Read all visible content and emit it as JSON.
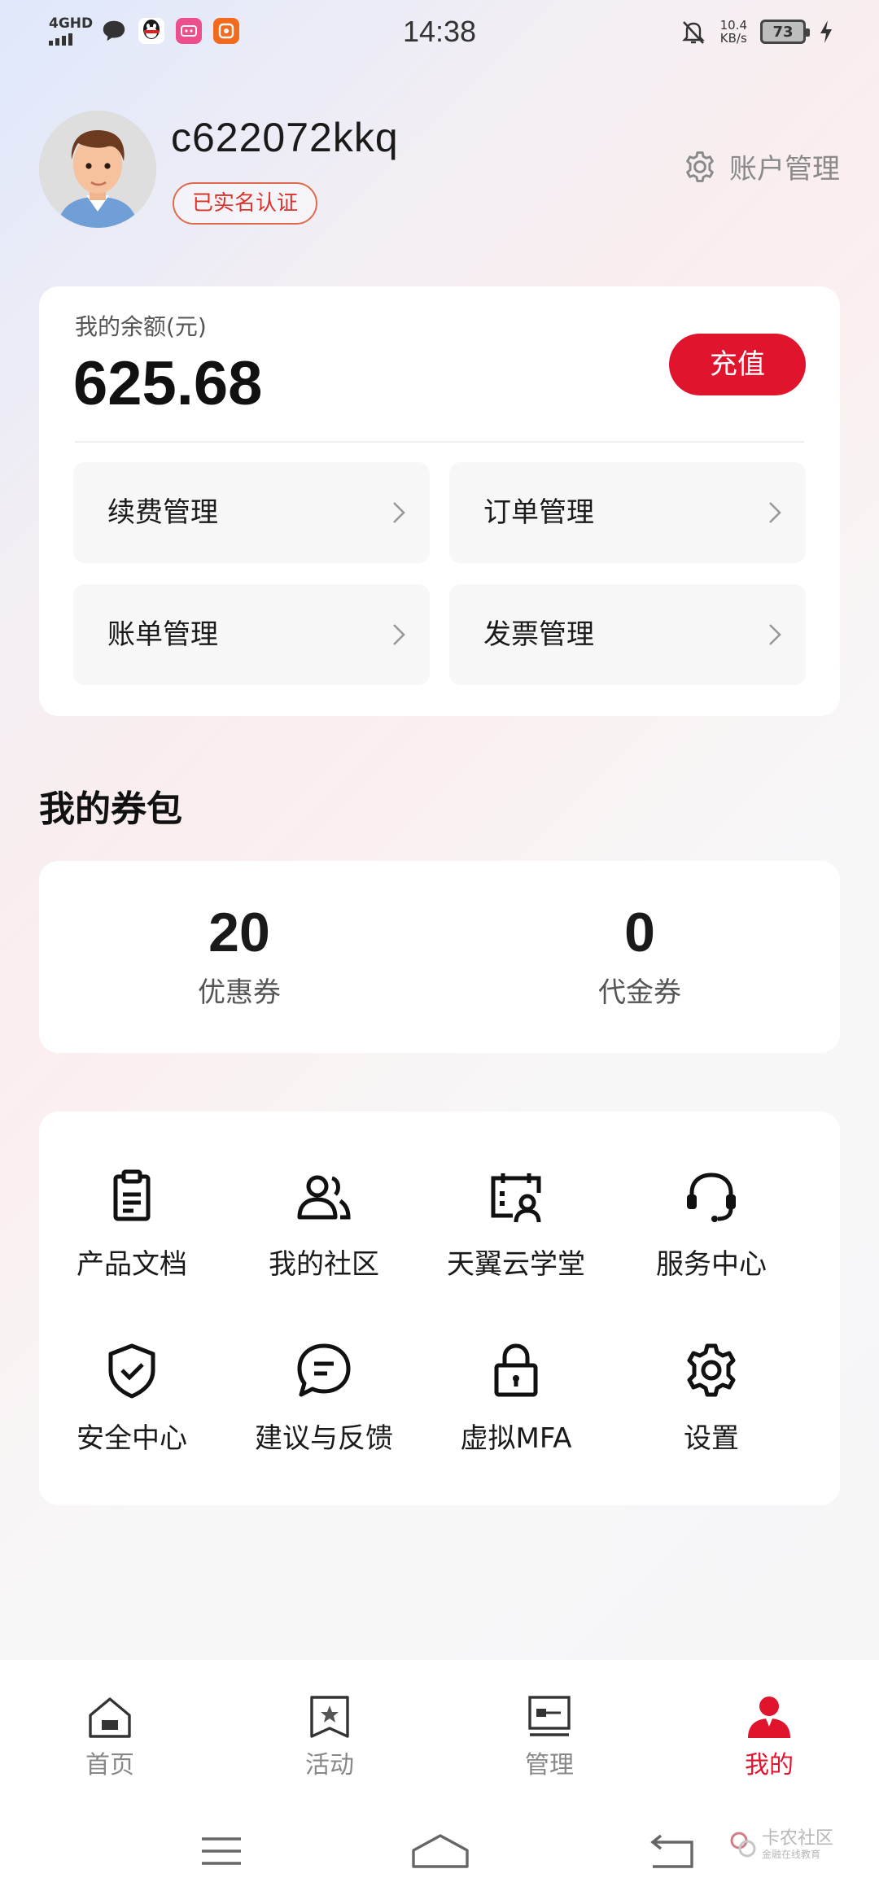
{
  "status_bar": {
    "network": "4GHD",
    "time": "14:38",
    "speed_value": "10.4",
    "speed_unit": "KB/s",
    "battery": "73"
  },
  "profile": {
    "username": "c622072kkq",
    "verified_badge": "已实名认证",
    "account_mgmt_label": "账户管理"
  },
  "balance": {
    "label": "我的余额(元)",
    "value": "625.68",
    "recharge_label": "充值",
    "buttons": [
      {
        "label": "续费管理"
      },
      {
        "label": "订单管理"
      },
      {
        "label": "账单管理"
      },
      {
        "label": "发票管理"
      }
    ]
  },
  "coupons": {
    "title": "我的券包",
    "items": [
      {
        "count": "20",
        "label": "优惠券"
      },
      {
        "count": "0",
        "label": "代金券"
      }
    ]
  },
  "services": [
    {
      "label": "产品文档",
      "icon": "clipboard-icon"
    },
    {
      "label": "我的社区",
      "icon": "community-icon"
    },
    {
      "label": "天翼云学堂",
      "icon": "academy-icon"
    },
    {
      "label": "服务中心",
      "icon": "headset-icon"
    },
    {
      "label": "安全中心",
      "icon": "shield-check-icon"
    },
    {
      "label": "建议与反馈",
      "icon": "feedback-icon"
    },
    {
      "label": "虚拟MFA",
      "icon": "lock-icon"
    },
    {
      "label": "设置",
      "icon": "gear-icon"
    }
  ],
  "bottom_nav": [
    {
      "label": "首页",
      "icon": "home-icon",
      "active": false
    },
    {
      "label": "活动",
      "icon": "activity-icon",
      "active": false
    },
    {
      "label": "管理",
      "icon": "manage-icon",
      "active": false
    },
    {
      "label": "我的",
      "icon": "profile-icon",
      "active": true
    }
  ],
  "watermark": {
    "title": "卡农社区",
    "subtitle": "金融在线教育"
  },
  "colors": {
    "accent": "#e0142d",
    "badge_border": "#e06a4c"
  }
}
